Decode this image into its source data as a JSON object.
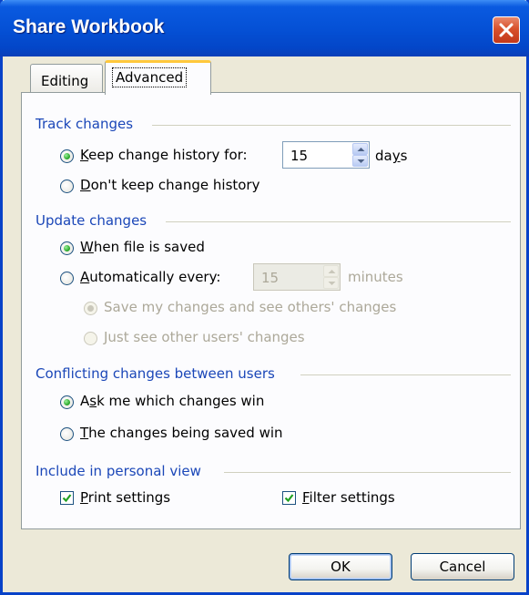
{
  "window": {
    "title": "Share Workbook"
  },
  "tabs": [
    {
      "label": "Editing",
      "active": false
    },
    {
      "label": "Advanced",
      "active": true
    }
  ],
  "track_changes": {
    "heading": "Track changes",
    "keep_history": {
      "label_pre": "",
      "label_key": "K",
      "label_rest": "eep change history for:",
      "checked": true
    },
    "days_value": "15",
    "days_unit_pre": "da",
    "days_unit_key": "y",
    "days_unit_rest": "s",
    "dont_keep": {
      "label_key": "D",
      "label_rest": "on't keep change history",
      "checked": false
    }
  },
  "update_changes": {
    "heading": "Update changes",
    "when_saved": {
      "label_key": "W",
      "label_rest": "hen file is saved",
      "checked": true
    },
    "auto_every": {
      "label_key": "A",
      "label_rest": "utomatically every:",
      "checked": false
    },
    "minutes_value": "15",
    "minutes_unit": "minutes",
    "save_and_see": {
      "label": "Save my changes and see others' changes",
      "checked": true,
      "enabled": false
    },
    "just_see": {
      "label": "Just see other users' changes",
      "checked": false,
      "enabled": false
    }
  },
  "conflicts": {
    "heading": "Conflicting changes between users",
    "ask_me": {
      "label_pre": "A",
      "label_key": "s",
      "label_rest": "k me which changes win",
      "checked": true
    },
    "being_saved": {
      "label_key": "T",
      "label_rest": "he changes being saved win",
      "checked": false
    }
  },
  "personal_view": {
    "heading": "Include in personal view",
    "print_settings": {
      "label_key": "P",
      "label_rest": "rint settings",
      "checked": true
    },
    "filter_settings": {
      "label_key": "F",
      "label_rest": "ilter settings",
      "checked": true
    }
  },
  "buttons": {
    "ok": "OK",
    "cancel": "Cancel"
  },
  "colors": {
    "title_bar": "#0551d6",
    "group_heading": "#1b47b8",
    "dialog_bg": "#ece9d8",
    "close_button": "#d8512c"
  },
  "icons": {
    "close": "close-icon",
    "spin_up": "spin-up-arrow-icon",
    "spin_down": "spin-down-arrow-icon",
    "check": "checkmark-icon"
  }
}
